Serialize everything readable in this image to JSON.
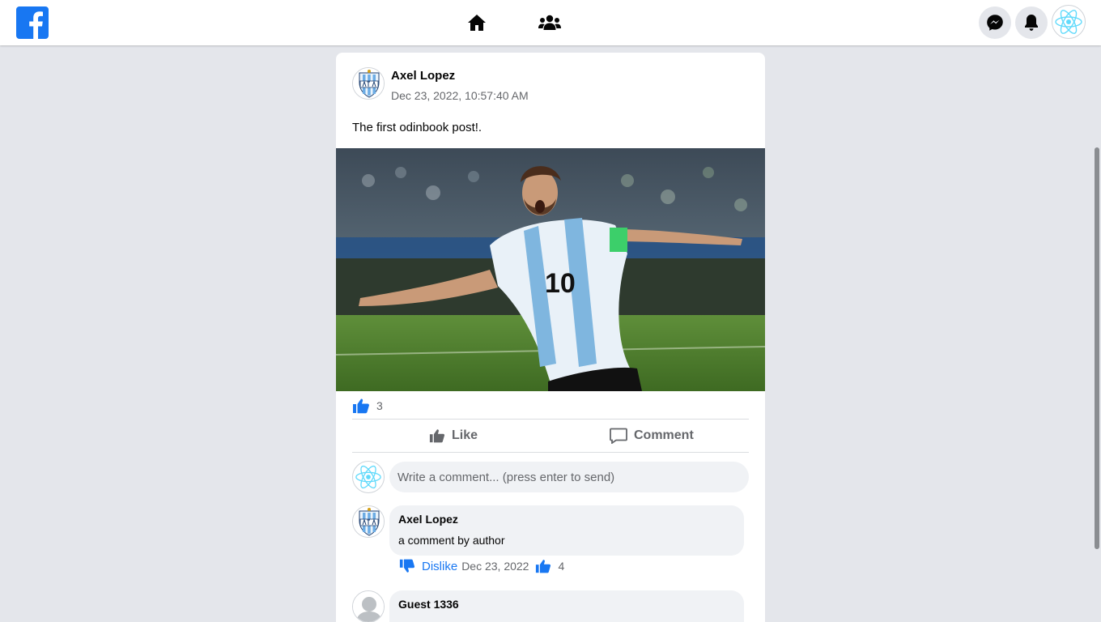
{
  "header": {
    "icons": [
      "facebook-logo",
      "home-icon",
      "friends-icon",
      "messenger-icon",
      "bell-icon",
      "react-avatar"
    ]
  },
  "post": {
    "author": "Axel Lopez",
    "date": "Dec 23, 2022, 10:57:40 AM",
    "text": "The first odinbook post!.",
    "likes_count": "3",
    "like_label": "Like",
    "comment_label": "Comment"
  },
  "comment_box": {
    "placeholder": "Write a comment... (press enter to send)"
  },
  "comments": [
    {
      "author": "Axel Lopez",
      "text": "a comment by author",
      "dislike_label": "Dislike",
      "date": "Dec 23, 2022",
      "likes_count": "4"
    },
    {
      "author": "Guest 1336"
    }
  ],
  "colors": {
    "accent": "#1877f2",
    "background": "#e4e6eb",
    "card": "#ffffff",
    "muted_text": "#65676b"
  }
}
